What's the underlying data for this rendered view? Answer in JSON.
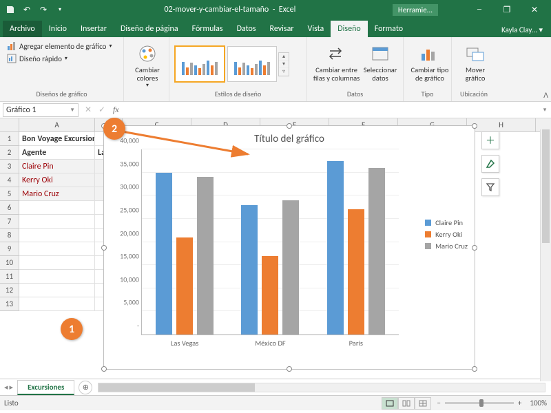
{
  "title": {
    "doc": "02-mover-y-cambiar-el-tamaño",
    "app": "Excel",
    "help": "Herramie..."
  },
  "user": "Kayla Clay...",
  "menu": {
    "archivo": "Archivo",
    "inicio": "Inicio",
    "insertar": "Insertar",
    "diseno_pagina": "Diseño de página",
    "formulas": "Fórmulas",
    "datos": "Datos",
    "revisar": "Revisar",
    "vista": "Vista",
    "diseno": "Diseño",
    "formato": "Formato"
  },
  "ribbon": {
    "add_element": "Agregar elemento de gráfico",
    "quick_layout": "Diseño rápido",
    "group_layouts": "Diseños de gráfico",
    "change_colors": "Cambiar colores",
    "group_styles": "Estilos de diseño",
    "switch_rowcol": "Cambiar entre filas y columnas",
    "select_data": "Seleccionar datos",
    "group_data": "Datos",
    "change_type": "Cambiar tipo de gráfico",
    "group_type": "Tipo",
    "move_chart": "Mover gráfico",
    "group_location": "Ubicación"
  },
  "namebox": "Gráfico 1",
  "fx": "fx",
  "columns": [
    "A",
    "B",
    "C",
    "D",
    "E",
    "F",
    "G",
    "H"
  ],
  "rows": [
    "1",
    "2",
    "3",
    "4",
    "5",
    "6",
    "7",
    "8",
    "9",
    "10",
    "11",
    "12",
    "13"
  ],
  "cells": {
    "a1": "Bon Voyage Excursiones",
    "a2": "Agente",
    "b2": "Las",
    "a3": "Claire Pin",
    "a4": "Kerry Oki",
    "a5": "Mario Cruz"
  },
  "chart_data": {
    "type": "bar",
    "title": "Título del gráfico",
    "categories": [
      "Las Vegas",
      "México DF",
      "Paris"
    ],
    "series": [
      {
        "name": "Claire Pin",
        "values": [
          35000,
          28000,
          37500
        ],
        "color": "#5B9BD5"
      },
      {
        "name": "Kerry Oki",
        "values": [
          21000,
          17000,
          27000
        ],
        "color": "#ED7D31"
      },
      {
        "name": "Mario Cruz",
        "values": [
          34000,
          29000,
          36000
        ],
        "color": "#A5A5A5"
      }
    ],
    "yticks": [
      0,
      5000,
      10000,
      15000,
      20000,
      25000,
      30000,
      35000,
      40000
    ],
    "ytick_labels": [
      "-",
      "5,000",
      "10,000",
      "15,000",
      "20,000",
      "25,000",
      "30,000",
      "35,000",
      "40,000"
    ],
    "xlabel": "",
    "ylabel": "",
    "ylim": [
      0,
      40000
    ]
  },
  "steps": {
    "1": "1",
    "2": "2"
  },
  "sheet": "Excursiones",
  "status": "Listo",
  "zoom": "100%"
}
